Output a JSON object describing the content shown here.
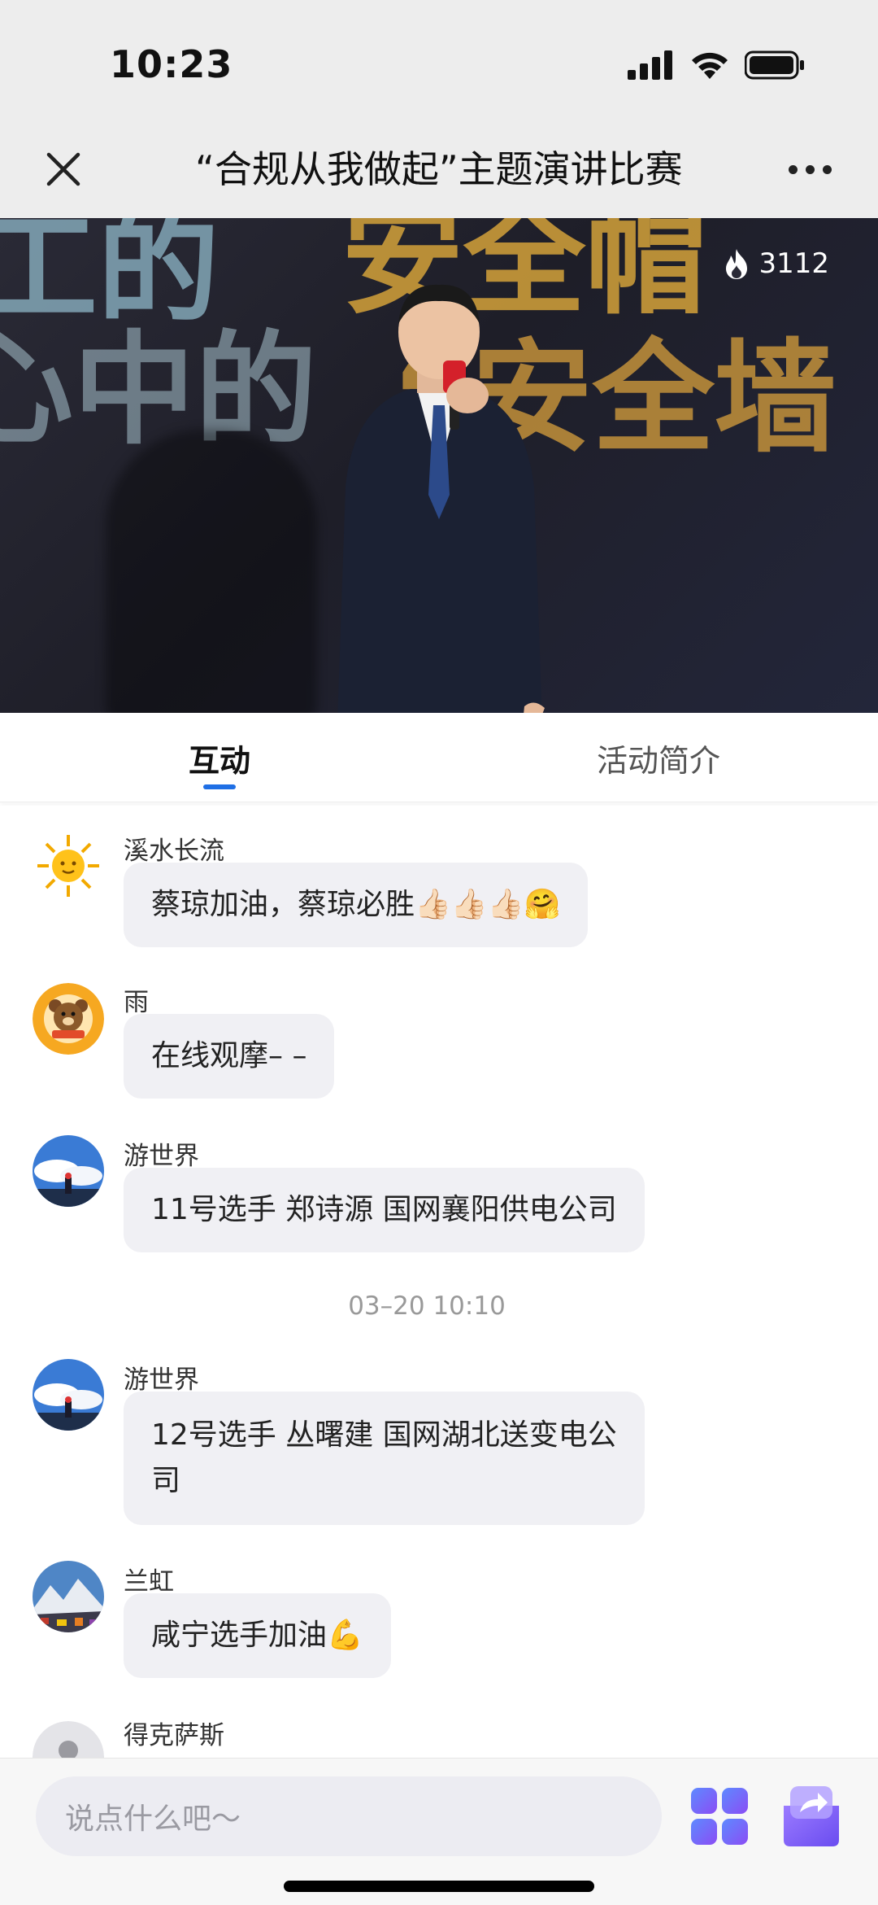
{
  "status_bar": {
    "time": "10:23"
  },
  "nav": {
    "title": "“合规从我做起”主题演讲比赛"
  },
  "video": {
    "heat_count": "3112",
    "background_text": [
      "工的",
      "安全帽",
      "心中的",
      "“安全墙"
    ]
  },
  "tabs": [
    {
      "label": "互动",
      "active": true
    },
    {
      "label": "活动简介",
      "active": false
    }
  ],
  "messages": [
    {
      "name": "溪水长流",
      "text": "蔡琼加油，蔡琼必胜👍🏻👍🏻👍🏻🤗",
      "avatar": "sun-avatar"
    },
    {
      "name": "雨",
      "text": "在线观摩– –",
      "avatar": "bear-avatar"
    },
    {
      "name": "游世界",
      "text": "11号选手 郑诗源 国网襄阳供电公司",
      "avatar": "sky-avatar"
    },
    {
      "name": "游世界",
      "text_lines": [
        "12号选手 丛曙建 国网湖北送变电公",
        "司"
      ],
      "avatar": "sky-avatar"
    },
    {
      "name": "兰虹",
      "text": "咸宁选手加油💪",
      "avatar": "mountain-avatar"
    },
    {
      "name": "得克萨斯",
      "avatar": "default-avatar"
    }
  ],
  "timestamp": "03–20 10:10",
  "input": {
    "placeholder": "说点什么吧～"
  },
  "colors": {
    "accent": "#1f6fe5",
    "bubble": "#f0f0f4",
    "app_icon": "#6a5cf0"
  }
}
